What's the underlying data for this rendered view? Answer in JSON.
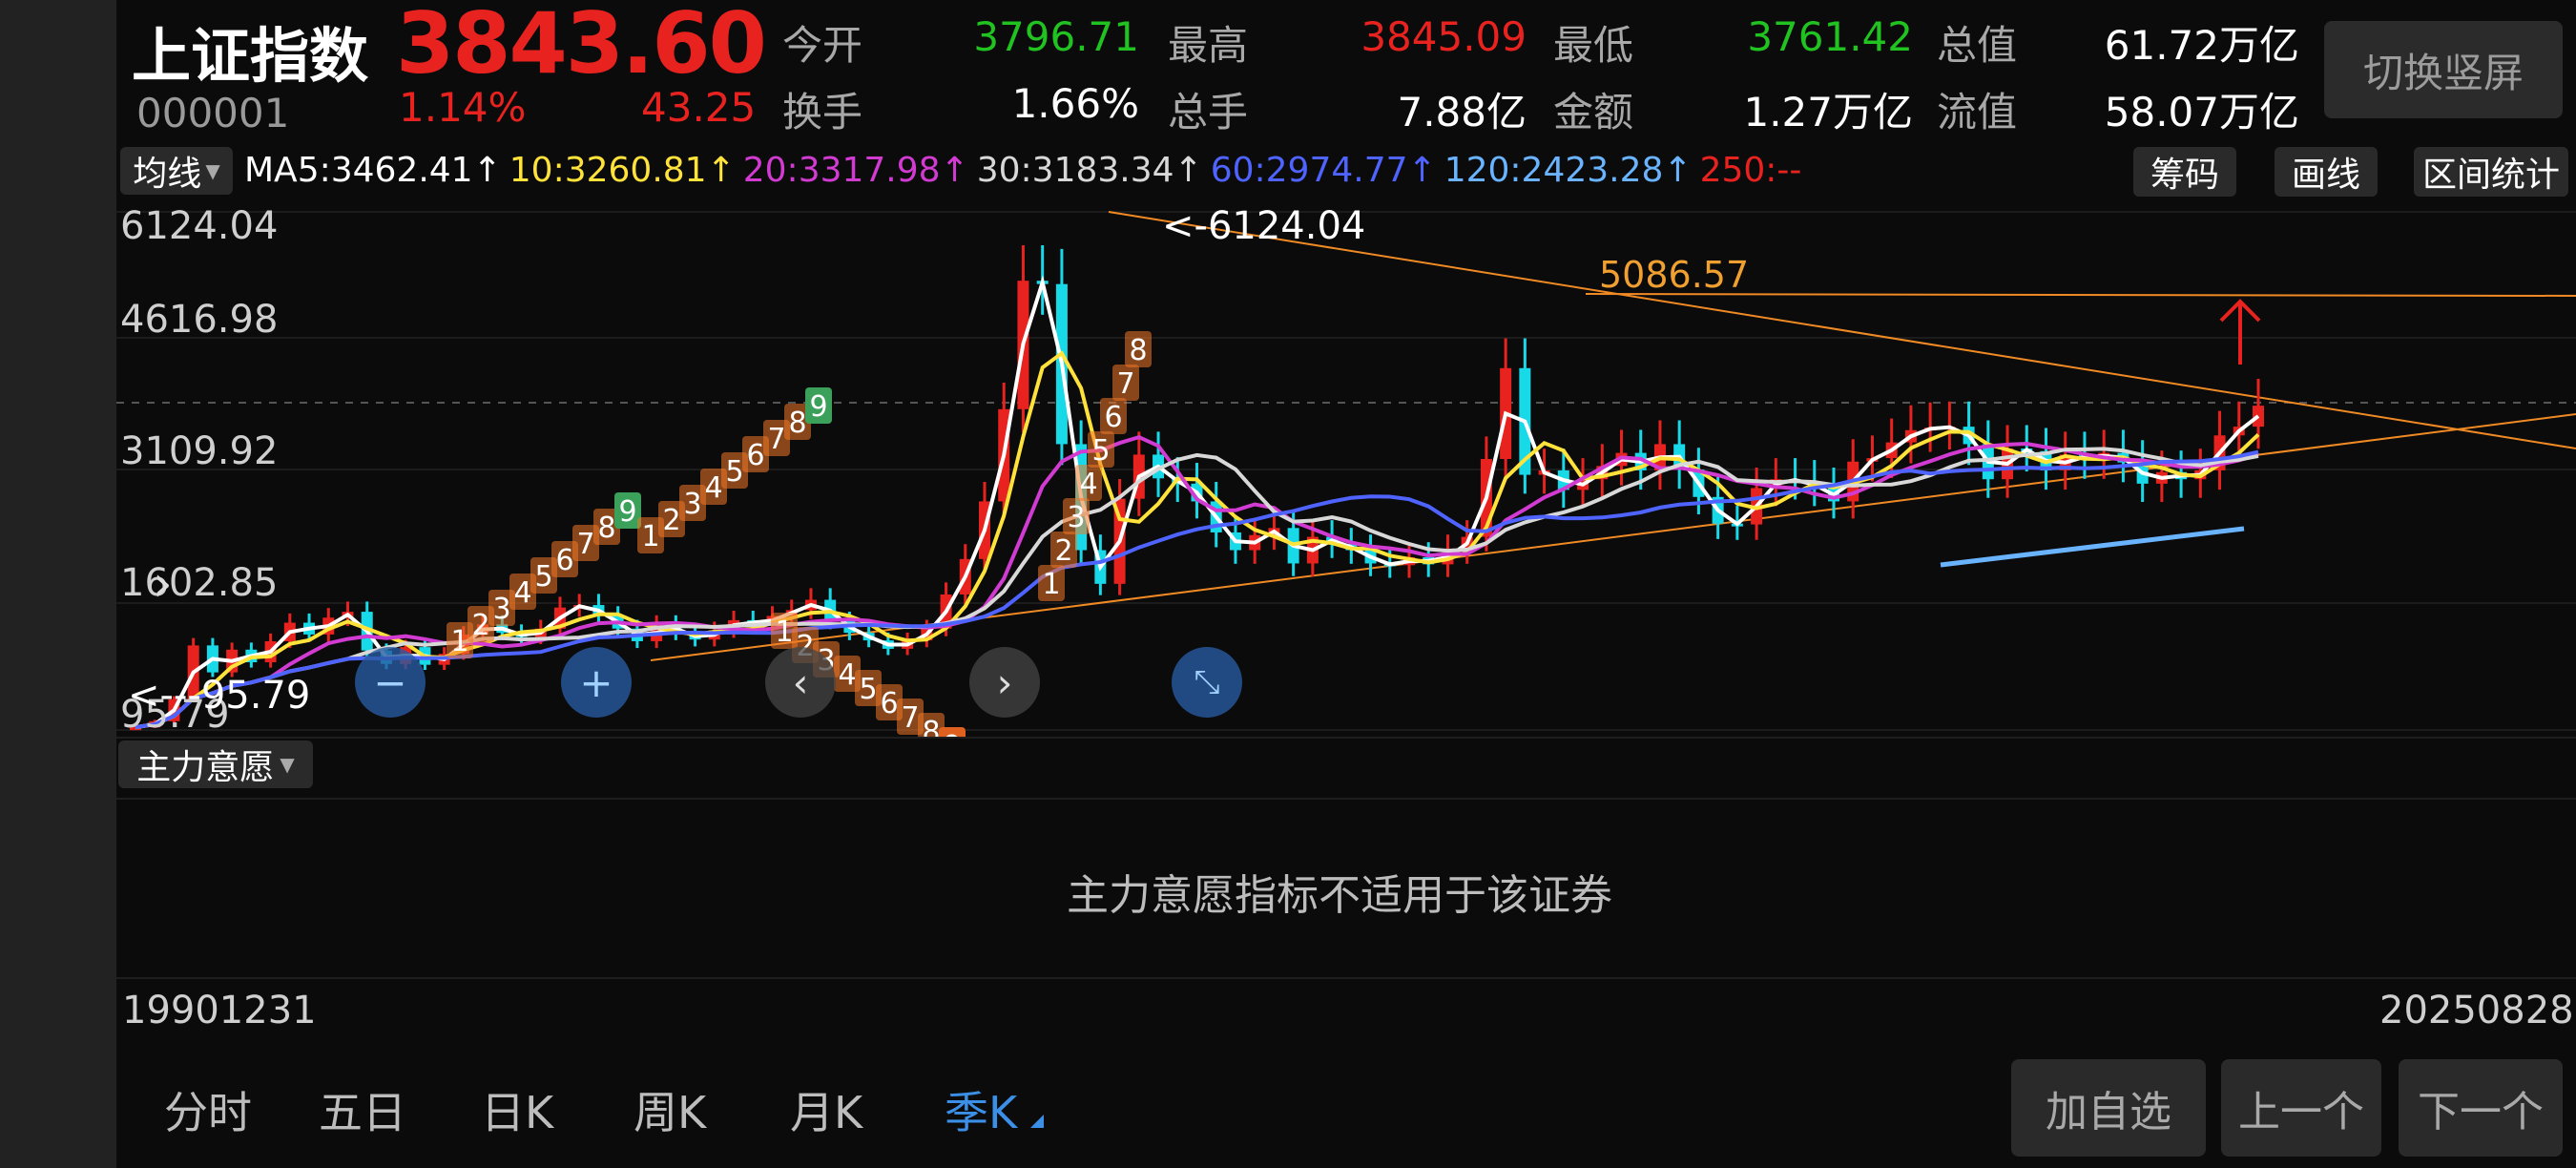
{
  "stock": {
    "name": "上证指数",
    "price": "3843.60",
    "code": "000001",
    "change_pct": "1.14%",
    "change_abs": "43.25"
  },
  "stats": [
    {
      "label": "今开",
      "value": "3796.71",
      "color": "#21c321"
    },
    {
      "label": "最高",
      "value": "3845.09",
      "color": "#e8231f"
    },
    {
      "label": "最低",
      "value": "3761.42",
      "color": "#21c321"
    },
    {
      "label": "总值",
      "value": "61.72万亿",
      "color": "#ffffff"
    },
    {
      "label": "换手",
      "value": "1.66%",
      "color": "#ffffff"
    },
    {
      "label": "总手",
      "value": "7.88亿",
      "color": "#ffffff"
    },
    {
      "label": "金额",
      "value": "1.27万亿",
      "color": "#ffffff"
    },
    {
      "label": "流值",
      "value": "58.07万亿",
      "color": "#ffffff"
    }
  ],
  "header": {
    "switch_label": "切换竖屏"
  },
  "ma_bar": {
    "selector": "均线",
    "items": [
      {
        "text": "MA5:3462.41↑",
        "color": "#ffffff"
      },
      {
        "text": "10:3260.81↑",
        "color": "#ffe23a"
      },
      {
        "text": "20:3317.98↑",
        "color": "#d23bd2"
      },
      {
        "text": "30:3183.34↑",
        "color": "#d8d8d8"
      },
      {
        "text": "60:2974.77↑",
        "color": "#4f63ff"
      },
      {
        "text": "120:2423.28↑",
        "color": "#6ab4ff"
      },
      {
        "text": "250:--",
        "color": "#e8231f"
      }
    ],
    "buttons": [
      "筹码",
      "画线",
      "区间统计"
    ]
  },
  "chart": {
    "y_labels": [
      "6124.04",
      "4616.98",
      "3109.92",
      "1602.85",
      "95.79"
    ],
    "high_marker": "<-6124.04",
    "low_marker": "<---95.79",
    "peak2_marker": "5086.57",
    "start_date": "19901231",
    "end_date": "20250828",
    "seq_labels": [
      "1",
      "2",
      "3",
      "4",
      "5",
      "6",
      "7",
      "8",
      "9"
    ],
    "colors": {
      "up": "#e8231f",
      "down": "#17d9e8",
      "ma5": "#ffffff",
      "ma10": "#ffe23a",
      "ma20": "#d23bd2",
      "ma30": "#d8d8d8",
      "ma60": "#4f63ff",
      "ma120": "#6ab4ff",
      "trend": "#f08a24"
    }
  },
  "indicator": {
    "selector": "主力意愿",
    "message": "主力意愿指标不适用于该证券"
  },
  "period_tabs": [
    "分时",
    "五日",
    "日K",
    "周K",
    "月K",
    "季K"
  ],
  "active_tab": "季K",
  "actions": [
    "加自选",
    "上一个",
    "下一个"
  ]
}
